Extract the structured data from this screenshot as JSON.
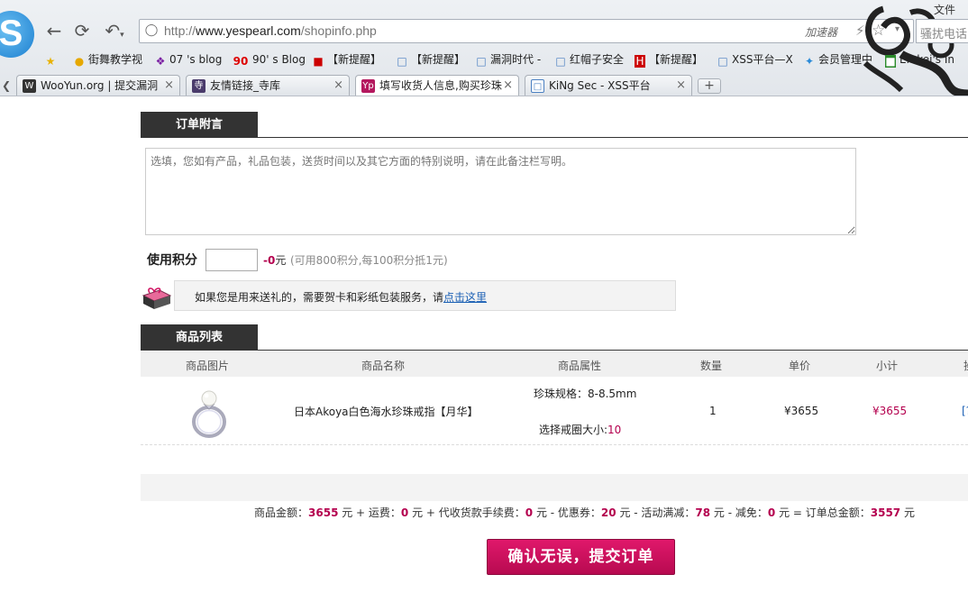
{
  "browser": {
    "url_prefix": "http://",
    "url_domain": "www.yespearl.com",
    "url_path": "/shopinfo.php",
    "accelerator_label": "加速器",
    "search_placeholder": "骚扰电话",
    "menu_file": "文件",
    "bookmarks": [
      {
        "label": "街舞教学视"
      },
      {
        "label": "07 's blog"
      },
      {
        "label": "90' s Blog"
      },
      {
        "label": "【新提醒】"
      },
      {
        "label": "【新提醒】"
      },
      {
        "label": "漏洞时代 -"
      },
      {
        "label": "红帽子安全"
      },
      {
        "label": "【新提醒】"
      },
      {
        "label": "XSS平台—X"
      },
      {
        "label": "会员管理中"
      },
      {
        "label": "Emkei's In"
      }
    ],
    "tabs": [
      {
        "label": "WooYun.org | 提交漏洞"
      },
      {
        "label": "友情链接_寺库"
      },
      {
        "label": "填写收货人信息,购买珍珠"
      },
      {
        "label": "KiNg Sec - XSS平台"
      }
    ],
    "new_tab": "+"
  },
  "order": {
    "remark_title": "订单附言",
    "remark_placeholder": "选填，您如有产品，礼品包装，送货时间以及其它方面的特别说明，请在此备注栏写明。",
    "points_label": "使用积分",
    "points_value_num": "-0",
    "points_value_unit": "元",
    "points_note": "(可用800积分,每100积分抵1元)",
    "gift_text": "如果您是用来送礼的，需要贺卡和彩纸包装服务，请",
    "gift_link": "点击这里",
    "list_title": "商品列表",
    "columns": [
      "商品图片",
      "商品名称",
      "商品属性",
      "数量",
      "单价",
      "小计",
      "操"
    ],
    "item": {
      "name": "日本Akoya白色海水珍珠戒指【月华】",
      "attr1": "珍珠规格：8-8.5mm",
      "attr2_label": "选择戒圈大小:",
      "attr2_value": "10",
      "qty": "1",
      "price": "¥3655",
      "subtotal": "¥3655",
      "action": "[?"
    },
    "totals": {
      "goods_label": "商品金额：",
      "goods": "3655",
      "shipping_label": " 元 + 运费：",
      "shipping": "0",
      "cod_label": " 元 + 代收货款手续费：",
      "cod": "0",
      "coupon_label": " 元 - 优惠券：",
      "coupon": "20",
      "promo_label": " 元 - 活动满减：",
      "promo": "78",
      "waive_label": " 元 - 减免：",
      "waive": "0",
      "total_label": " 元 = 订单总金额：",
      "total": "3557",
      "unit_end": " 元"
    },
    "submit_label": "确认无误，提交订单"
  }
}
